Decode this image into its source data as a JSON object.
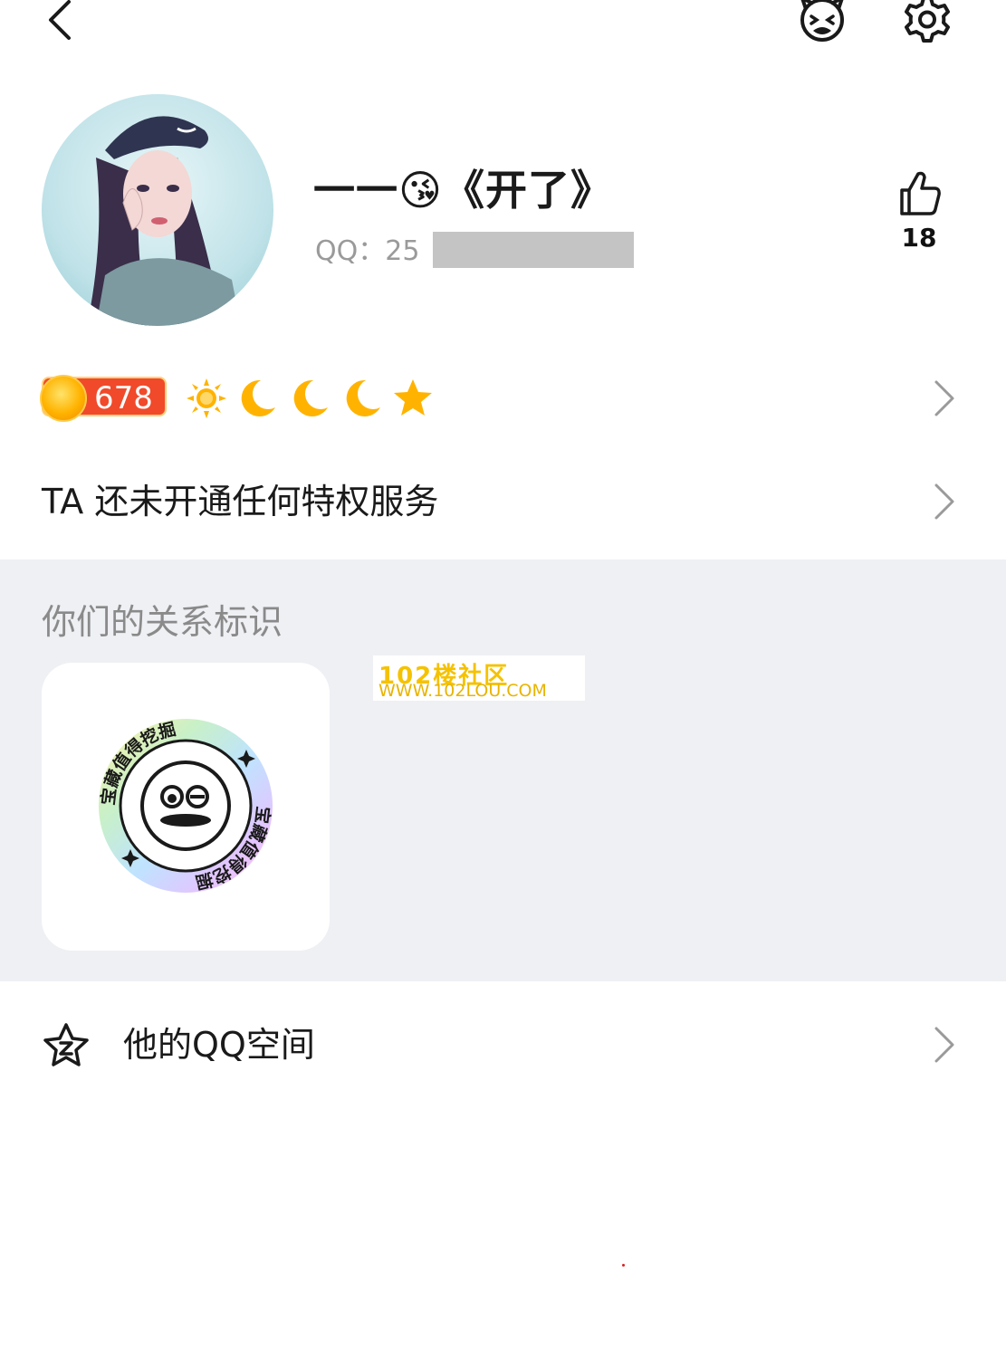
{
  "header": {
    "back_icon": "chevron-left-icon",
    "pet_icon": "pet-face-icon",
    "settings_icon": "gear-icon"
  },
  "profile": {
    "nickname": "一一😘《开了》",
    "qq_label": "QQ：25",
    "qq_masked": true,
    "like_icon": "thumbs-up-icon",
    "like_count": "18"
  },
  "level": {
    "coin_value": "678",
    "icons": [
      "sun-icon",
      "moon-icon",
      "moon-icon",
      "moon-icon",
      "star-icon"
    ]
  },
  "privilege": {
    "text": "TA 还未开通任何特权服务"
  },
  "relation": {
    "title": "你们的关系标识",
    "badge_text": "宝藏值得挖掘",
    "watermark_line1": "102楼社区",
    "watermark_line2": "WWW.102LOU.COM"
  },
  "qzone": {
    "label": "他的QQ空间",
    "icon": "qzone-star-icon"
  },
  "colors": {
    "background": "#ffffff",
    "section_bg": "#eff0f4",
    "coin_badge": "#f04a2a",
    "muted_text": "#9a9a9a",
    "level_gold": "#ffb300"
  }
}
